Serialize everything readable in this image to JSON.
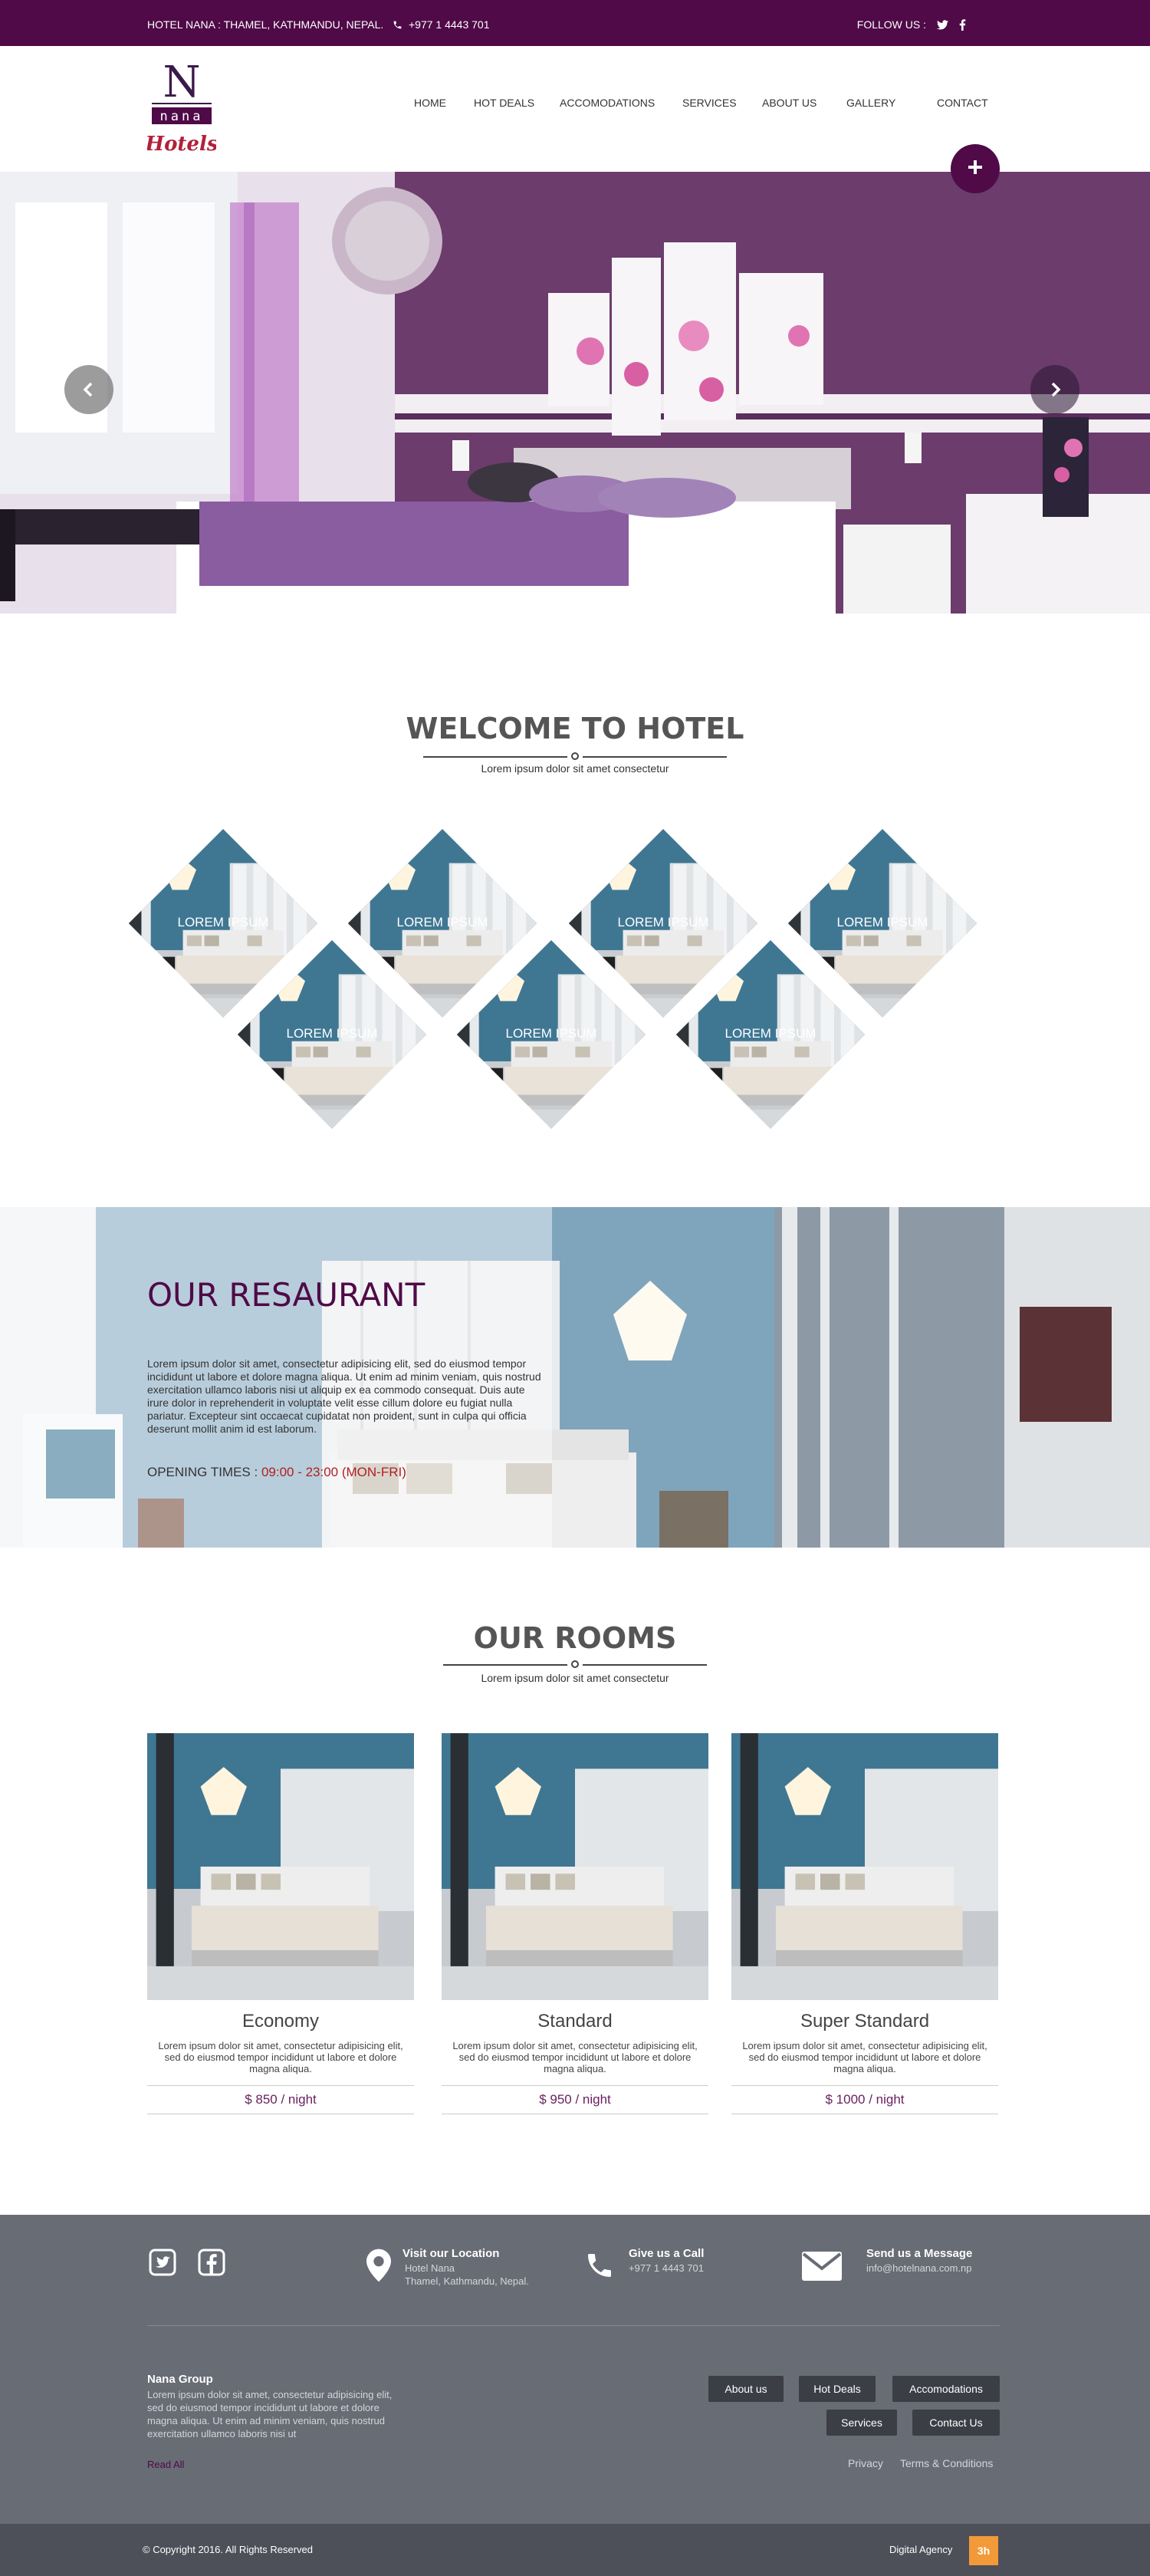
{
  "topbar": {
    "address": "HOTEL NANA : THAMEL, KATHMANDU, NEPAL.",
    "phone": "+977 1 4443 701",
    "follow_label": "FOLLOW US :"
  },
  "logo": {
    "letter": "N",
    "word1": "nana",
    "word2": "Hotels"
  },
  "nav": {
    "items": [
      {
        "label": "HOME"
      },
      {
        "label": "HOT DEALS"
      },
      {
        "label": "ACCOMODATIONS"
      },
      {
        "label": "SERVICES"
      },
      {
        "label": "ABOUT US"
      },
      {
        "label": "GALLERY"
      },
      {
        "label": "CONTACT"
      }
    ]
  },
  "welcome": {
    "title": "WELCOME TO HOTEL",
    "subtitle": "Lorem ipsum dolor sit amet consectetur",
    "tiles": [
      {
        "label": "LOREM IPSUM"
      },
      {
        "label": "LOREM IPSUM"
      },
      {
        "label": "LOREM IPSUM"
      },
      {
        "label": "LOREM IPSUM"
      },
      {
        "label": "LOREM IPSUM"
      },
      {
        "label": "LOREM IPSUM"
      },
      {
        "label": "LOREM IPSUM"
      }
    ]
  },
  "restaurant": {
    "title": "OUR RESAURANT",
    "text": "Lorem ipsum dolor sit amet, consectetur adipisicing elit, sed do eiusmod tempor incididunt ut labore et dolore magna aliqua. Ut enim ad minim veniam, quis nostrud exercitation ullamco laboris nisi ut aliquip ex ea commodo consequat. Duis aute irure dolor in reprehenderit in voluptate velit esse cillum dolore eu fugiat nulla pariatur. Excepteur sint occaecat cupidatat non proident, sunt in culpa qui officia deserunt mollit anim id est laborum.",
    "hours_label": "OPENING TIMES : ",
    "hours_value": "09:00 - 23:00 (MON-FRI)"
  },
  "rooms": {
    "title": "OUR ROOMS",
    "subtitle": "Lorem ipsum dolor sit amet consectetur",
    "items": [
      {
        "name": "Economy",
        "desc": "Lorem ipsum dolor sit amet, consectetur adipisicing elit, sed do eiusmod tempor incididunt ut labore et dolore magna aliqua.",
        "price": "$ 850  /  night"
      },
      {
        "name": "Standard",
        "desc": "Lorem ipsum dolor sit amet, consectetur adipisicing elit, sed do eiusmod tempor incididunt ut labore et dolore magna aliqua.",
        "price": "$ 950  /  night"
      },
      {
        "name": "Super Standard",
        "desc": "Lorem ipsum dolor sit amet, consectetur adipisicing elit, sed do eiusmod tempor incididunt ut labore et dolore magna aliqua.",
        "price": "$ 1000  /  night"
      }
    ]
  },
  "footer": {
    "location_title": "Visit our Location",
    "location_line1": "Hotel Nana",
    "location_line2": "Thamel, Kathmandu, Nepal.",
    "call_title": "Give us  a Call",
    "call_number": "+977 1 4443 701",
    "message_title": "Send us a Message",
    "message_email": "info@hotelnana.com.np",
    "group_title": "Nana Group",
    "group_text": "Lorem ipsum dolor sit amet, consectetur adipisicing elit, sed do eiusmod tempor incididunt ut labore et dolore magna aliqua. Ut enim ad minim veniam, quis nostrud exercitation ullamco laboris nisi ut",
    "read_all": "Read All",
    "buttons": {
      "about": "About us",
      "hot_deals": "Hot Deals",
      "accomodations": "Accomodations",
      "services": "Services",
      "contact": "Contact  Us"
    },
    "privacy": "Privacy",
    "terms": "Terms & Conditions"
  },
  "bottombar": {
    "copyright": "© Copyright 2016. All Rights Reserved",
    "agency": "Digital Agency",
    "agency_logo": "3h"
  },
  "colors": {
    "brand_purple": "#4f0a47",
    "footer_gray": "#686c75",
    "bottom_gray": "#4d5058",
    "hours_red": "#b21f1f",
    "agency_orange": "#f29a38"
  },
  "icons": [
    "phone-icon",
    "twitter-icon",
    "facebook-icon",
    "plus-icon",
    "chevron-left-icon",
    "chevron-right-icon",
    "location-pin-icon",
    "phone-icon",
    "envelope-icon"
  ]
}
